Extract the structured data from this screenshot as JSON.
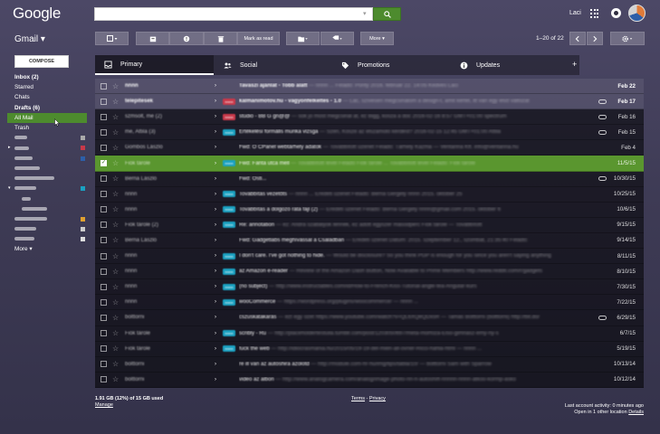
{
  "header": {
    "logo": "Google",
    "search": {
      "value": "",
      "placeholder": ""
    },
    "user_name": "Laci"
  },
  "subheader": {
    "app_label": "Gmail ▾",
    "more_label": "More ▾",
    "move_to_label": "Mark as read",
    "pager": "1–20 of 22"
  },
  "sidebar": {
    "compose_label": "COMPOSE",
    "items": [
      {
        "label": "Inbox (2)",
        "bold": true
      },
      {
        "label": "Starred"
      },
      {
        "label": "Chats"
      },
      {
        "label": "Drafts (6)",
        "bold": true
      },
      {
        "label": "All Mail",
        "active": true
      },
      {
        "label": "Trash"
      }
    ],
    "more_label": "More ▾"
  },
  "tabs": [
    {
      "label": "Primary",
      "icon": "inbox-icon"
    },
    {
      "label": "Social",
      "icon": "people-icon"
    },
    {
      "label": "Promotions",
      "icon": "tag-icon"
    },
    {
      "label": "Updates",
      "icon": "info-icon"
    }
  ],
  "colors": {
    "accent": "#5a962f",
    "search_button": "#4d8b2e"
  },
  "emails": [
    {
      "sender": "nnnn",
      "badge": "",
      "badge_color": "",
      "subject": "Tavaszi ajánlat - Tobb alatt",
      "snippet": "— nnnn ... Feladó: Ponty 2016. február 22. 14:05 Kedves Laci",
      "date": "Feb 22",
      "unread": true,
      "clip": false
    },
    {
      "sender": "telepitesek",
      "badge": "nnnn",
      "badge_color": "#c9394a",
      "subject": "kalmanimotov.hu - vagyonfelkeltes - 1.0",
      "snippet": "— Lac, szívesen megcsinálom a design-t, amit kértél, itt van egy első változat",
      "date": "Feb 17",
      "unread": true,
      "clip": true
    },
    {
      "sender": "szmsolt, me (2)",
      "badge": "nnnn",
      "badge_color": "#c9394a",
      "subject": "stúdió - BB G gn@@",
      "snippet": "— sok jo most megcsinál at, ez Bigg, kosza a doc 2016-02-16 8:57 GMT+01:00 spectrum",
      "date": "Feb 16",
      "unread": false,
      "clip": true
    },
    {
      "sender": "me, Attila (3)",
      "badge": "nnnn",
      "badge_color": "#1aa1c1",
      "subject": "Értékelési formális munka vizsga",
      "snippet": "— Szeri, Kösze az elszámoló kérdést? 2016-02-15 12:45 GMT+01:00 Attila",
      "date": "Feb 15",
      "unread": false,
      "clip": true
    },
    {
      "sender": "Gombos László",
      "badge": "",
      "badge_color": "",
      "subject": "Fwd: Ö CPanel webtárhely adatok",
      "snippet": "— Továbbított üzenet Feladó: Tárhely Kazma — Ventanna Kft. info@ventanna.hu",
      "date": "Feb 4",
      "unread": false,
      "clip": false
    },
    {
      "sender": "Fiók tárole",
      "badge": "nnnn",
      "badge_color": "#1aa1c1",
      "subject": "Fwd: Fanta utca mell",
      "snippet": "— Továbbított levél Feladó Fiók tárole ... Továbbított levél Feladó: Fiók tárole",
      "date": "11/5/15",
      "unread": false,
      "clip": false,
      "selected": true
    },
    {
      "sender": "Berna László",
      "badge": "",
      "badge_color": "",
      "subject": "Fwd: Östi...",
      "snippet": "",
      "date": "10/30/15",
      "unread": false,
      "clip": true
    },
    {
      "sender": "nnnn",
      "badge": "nnnn",
      "badge_color": "#1aa1c1",
      "subject": "Továbbítás vezetőts",
      "snippet": "— nnnn ... Eredeti üzenet Feladó: Berna Gergely nnnn 2015. október 25",
      "date": "10/25/15",
      "unread": false,
      "clip": false
    },
    {
      "sender": "nnnn",
      "badge": "nnnn",
      "badge_color": "#1aa1c1",
      "subject": "Továbbítás a dolgozó ráta fájl (2)",
      "snippet": "— Eredeti üzenet Feladó: Berna Gergely nnnn@gmail.com 2015. október 6",
      "date": "10/6/15",
      "unread": false,
      "clip": false
    },
    {
      "sender": "Fiók tárole (2)",
      "badge": "nnnn",
      "badge_color": "#1aa1c1",
      "subject": "Re: annotation",
      "snippet": "— ez: Andrá szabályok lennék, ez adott egyszer másodperc Fiók tárole — Továbbított",
      "date": "9/15/15",
      "unread": false,
      "clip": false
    },
    {
      "sender": "Berna László",
      "badge": "",
      "badge_color": "",
      "subject": "Fwd: Gadgetlabs meghívással a Családban",
      "snippet": "— Eredeti üzenet Dátum: 2015. szeptember 12., szombat, 21:35:40 Feladó:",
      "date": "9/14/15",
      "unread": false,
      "clip": false
    },
    {
      "sender": "nnnn",
      "badge": "nnnn",
      "badge_color": "#1aa1c1",
      "subject": "I don't care. I've got nothing to hide.",
      "snippet": "— Would be disclosure? So you think PGP is enough for you since you aren't saying anything",
      "date": "8/11/15",
      "unread": false,
      "clip": false
    },
    {
      "sender": "nnnn",
      "badge": "nnnn",
      "badge_color": "#1aa1c1",
      "subject": "az Amazon e-reader",
      "snippet": "— Review of the Amazon Dash Button, Now Available to Prime Members http://www.reddit.com/r/gadgets",
      "date": "8/10/15",
      "unread": false,
      "clip": false
    },
    {
      "sender": "nnnn",
      "badge": "nnnn",
      "badge_color": "#1aa1c1",
      "subject": "(no subject)",
      "snippet": "— http://www.instructables.com/id/How-to-French-Kiss-Tutorial-angle-tea-Angular-kurs",
      "date": "7/30/15",
      "unread": false,
      "clip": false
    },
    {
      "sender": "nnnn",
      "badge": "nnnn",
      "badge_color": "#1aa1c1",
      "subject": "wooCommerce",
      "snippet": "— https://wordpress.org/plugins/woocommerce/ — nnnn ...",
      "date": "7/22/15",
      "unread": false,
      "clip": false
    },
    {
      "sender": "bolttorni",
      "badge": "",
      "badge_color": "",
      "subject": "cszuskatakarás",
      "snippet": "— ezt egy ozet https://www.youtube.com/watch?v=QL6XQeQDxsR — Tamás Bolttorni (bolttorni) http://bit.do/",
      "date": "6/29/15",
      "unread": false,
      "clip": true
    },
    {
      "sender": "Fiók tárole",
      "badge": "nnnn",
      "badge_color": "#1aa1c1",
      "subject": "scribly - Ru",
      "snippet": "— http://placeholdertestuila.tumblr.com/post/1203050697/meta-morfoza-Elso-gimnasz-emy-ny-s",
      "date": "6/7/15",
      "unread": false,
      "clip": false
    },
    {
      "sender": "Fiók tárole",
      "badge": "nnnn",
      "badge_color": "#1aa1c1",
      "subject": "fuck the web",
      "snippet": "— http://idiocrasmania.hu/2015/05/19-19-del-mien-all-ovner-Ricci-hahla-html — nnnn ...",
      "date": "5/19/15",
      "unread": false,
      "clip": false
    },
    {
      "sender": "bolttorni",
      "badge": "",
      "badge_color": "",
      "subject": "re ill van az autóshira azolotd",
      "snippet": "— http://module.com-hr-hu/img/tips/tabla/10/ — bolttorni Sam with Sparrow",
      "date": "10/13/14",
      "unread": false,
      "clip": false
    },
    {
      "sender": "bolttorni",
      "badge": "",
      "badge_color": "",
      "subject": "video az albon",
      "snippet": "— http://www.analogcamera.com/analog/image-photo-nn-n-autoshift-nnnnn-nnnn-atkoo-kormp-asko",
      "date": "10/12/14",
      "unread": false,
      "clip": false
    }
  ],
  "footer": {
    "storage": "1.91 GB (12%) of 15 GB used",
    "manage": "Manage",
    "terms": "Terms",
    "separator": " - ",
    "privacy": "Privacy",
    "activity": "Last account activity: 0 minutes ago",
    "open_in": "Open in 1 other location",
    "details": "Details"
  }
}
